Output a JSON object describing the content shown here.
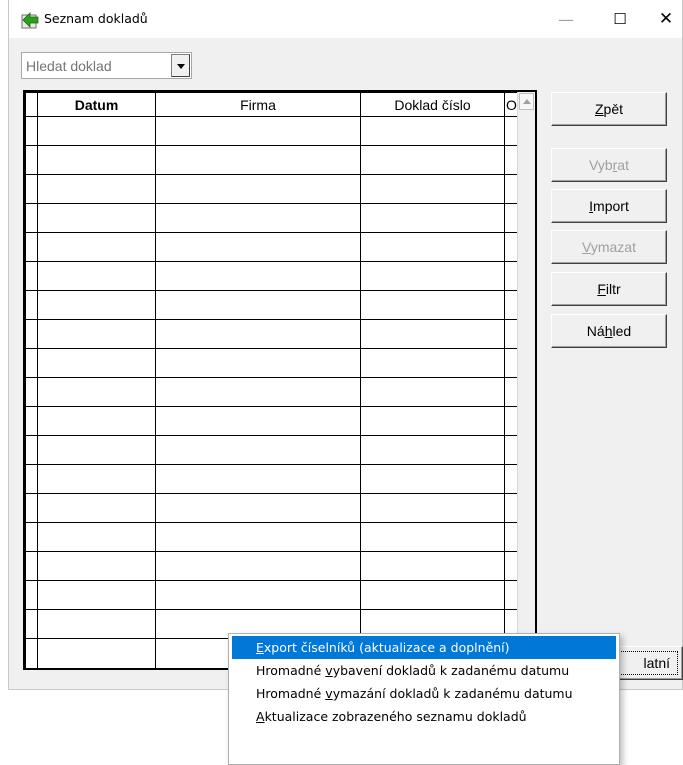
{
  "window": {
    "title": "Seznam dokladů",
    "controls": {
      "minimize": "—",
      "maximize": "☐",
      "close": "✕"
    }
  },
  "search": {
    "placeholder": "Hledat doklad",
    "value": ""
  },
  "table": {
    "columns": [
      "Datum",
      "Firma",
      "Doklad číslo",
      "O"
    ],
    "row_count": 19
  },
  "buttons": [
    {
      "label": "Zpět",
      "accel": "Z",
      "enabled": true
    },
    {
      "label": "Vybrat",
      "accel": "r",
      "enabled": false
    },
    {
      "label": "Import",
      "accel": "I",
      "enabled": true
    },
    {
      "label": "Vymazat",
      "accel": "V",
      "enabled": false
    },
    {
      "label": "Filtr",
      "accel": "F",
      "enabled": true
    },
    {
      "label": "Náhled",
      "accel": "h",
      "enabled": true
    }
  ],
  "ostatni_button": {
    "label": "Ostatní",
    "visible_label": "latní"
  },
  "context_menu": {
    "items": [
      {
        "label": "Export číselníků (aktualizace a doplnění)",
        "accel": "E",
        "selected": true
      },
      {
        "label": "Hromadné vybavení dokladů k zadanému datumu",
        "accel": "v",
        "selected": false
      },
      {
        "label": "Hromadné vymazání dokladů k zadanému datumu",
        "accel": "v",
        "selected": false
      },
      {
        "label": "Aktualizace zobrazeného seznamu dokladů",
        "accel": "A",
        "selected": false
      }
    ]
  },
  "colors": {
    "accent": "#0078d7",
    "app_icon_green": "#2e9e1e",
    "disabled_text": "#a0a0a0"
  },
  "icons": [
    "app-icon",
    "dropdown-arrow-icon",
    "scroll-up-arrow-icon"
  ]
}
